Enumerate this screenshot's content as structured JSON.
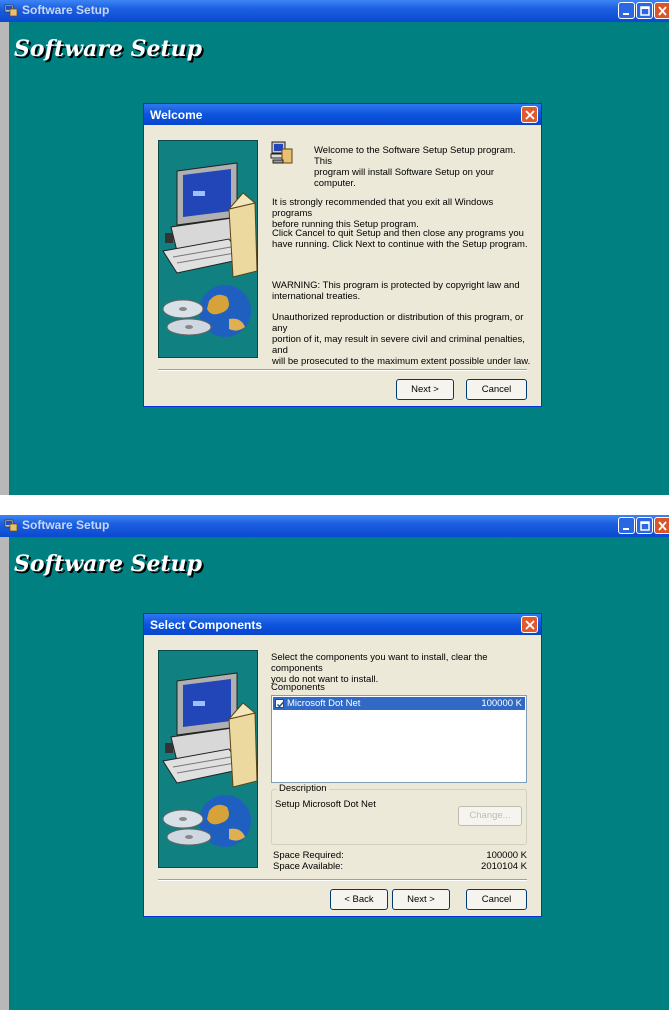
{
  "app_title": "Software Setup",
  "banner_title": "Software Setup",
  "welcome": {
    "dialog_title": "Welcome",
    "intro_line1": "Welcome to the Software Setup Setup program.  This",
    "intro_line2": "program will install Software Setup on your computer.",
    "p2_line1": "It is strongly recommended that you exit all Windows programs",
    "p2_line2": "before running this Setup program.",
    "p3_line1": "Click Cancel to quit Setup and then close any programs you",
    "p3_line2": "have running.  Click Next to continue with the Setup program.",
    "p4_line1": "WARNING: This program is protected by copyright law and",
    "p4_line2": "international treaties.",
    "p5_line1": "Unauthorized reproduction or distribution of this program, or any",
    "p5_line2": "portion of it, may result in severe civil and criminal penalties, and",
    "p5_line3": "will be prosecuted to the maximum extent possible under law.",
    "next_label": "Next >",
    "cancel_label": "Cancel"
  },
  "components": {
    "dialog_title": "Select Components",
    "instr_line1": "Select the components you want to install, clear the components",
    "instr_line2": "you do not want to install.",
    "components_label": "Components",
    "items": [
      {
        "name": "Microsoft Dot Net",
        "size": "100000 K",
        "checked": true
      }
    ],
    "description_legend": "Description",
    "description_text": "Setup Microsoft Dot Net",
    "change_label": "Change...",
    "space_required_label": "Space Required:",
    "space_required_value": "100000 K",
    "space_available_label": "Space Available:",
    "space_available_value": "2010104 K",
    "back_label": "< Back",
    "next_label": "Next >",
    "cancel_label": "Cancel"
  },
  "icons": [
    "setup-app-icon",
    "minimize-icon",
    "maximize-icon",
    "close-icon",
    "computer-illustration",
    "setup-small-icon",
    "checkbox-icon"
  ],
  "colors": {
    "desktop": "#008080",
    "titlebar": "#0a49d1",
    "dialog_bg": "#ece9d8",
    "selection": "#316ac5"
  }
}
